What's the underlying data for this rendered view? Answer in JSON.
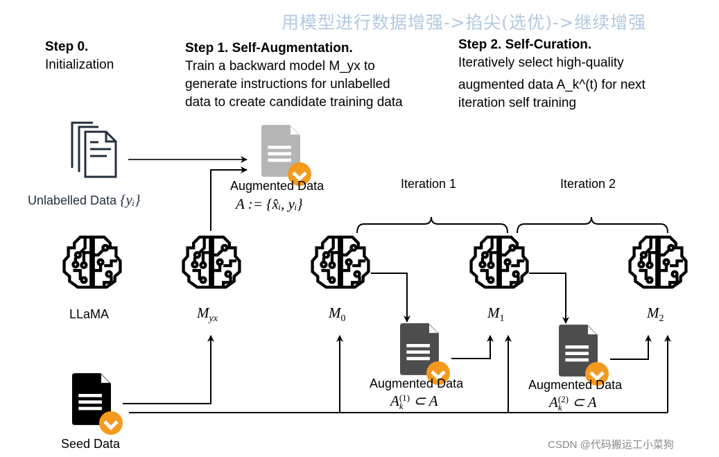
{
  "watermark_top": "用模型进行数据增强->掐尖(选优)->继续增强",
  "watermark_bottom": "CSDN @代码搬运工小菜狗",
  "steps": {
    "step0": {
      "title": "Step 0.",
      "body": [
        "Initialization"
      ]
    },
    "step1": {
      "title": "Step 1. Self-Augmentation.",
      "body": [
        "Train a backward model M_yx to",
        "generate instructions for unlabelled",
        "data to create candidate training data"
      ]
    },
    "step2": {
      "title": "Step 2. Self-Curation.",
      "body": [
        "Iteratively select high-quality",
        "augmented data A_k^(t) for next",
        "iteration self training"
      ]
    }
  },
  "nodes": {
    "unlabelled": {
      "label": "Unlabelled Data",
      "math": "{yᵢ}"
    },
    "augmented": {
      "label": "Augmented Data",
      "math": "A := {x̂ᵢ, yᵢ}"
    },
    "llama": {
      "label": "LLaMA"
    },
    "m_yx": {
      "label": "M",
      "sub": "yx"
    },
    "m0": {
      "label": "M",
      "sub": "0"
    },
    "m1": {
      "label": "M",
      "sub": "1"
    },
    "m2": {
      "label": "M",
      "sub": "2"
    },
    "aug1": {
      "label": "Augmented Data",
      "math": "A",
      "sub": "k",
      "sup": "(1)",
      "rest": " ⊂ A"
    },
    "aug2": {
      "label": "Augmented Data",
      "math": "A",
      "sub": "k",
      "sup": "(2)",
      "rest": " ⊂ A"
    },
    "seed": {
      "label": "Seed Data"
    }
  },
  "iterations": [
    "Iteration 1",
    "Iteration 2"
  ],
  "colors": {
    "check": "#f39a1f",
    "doc_gray": "#b5b5b5",
    "doc_dark": "#4d4d4d",
    "doc_black": "#000000",
    "unlabelled_icon": "#232f3e",
    "watermark": "#b3c8e0"
  }
}
